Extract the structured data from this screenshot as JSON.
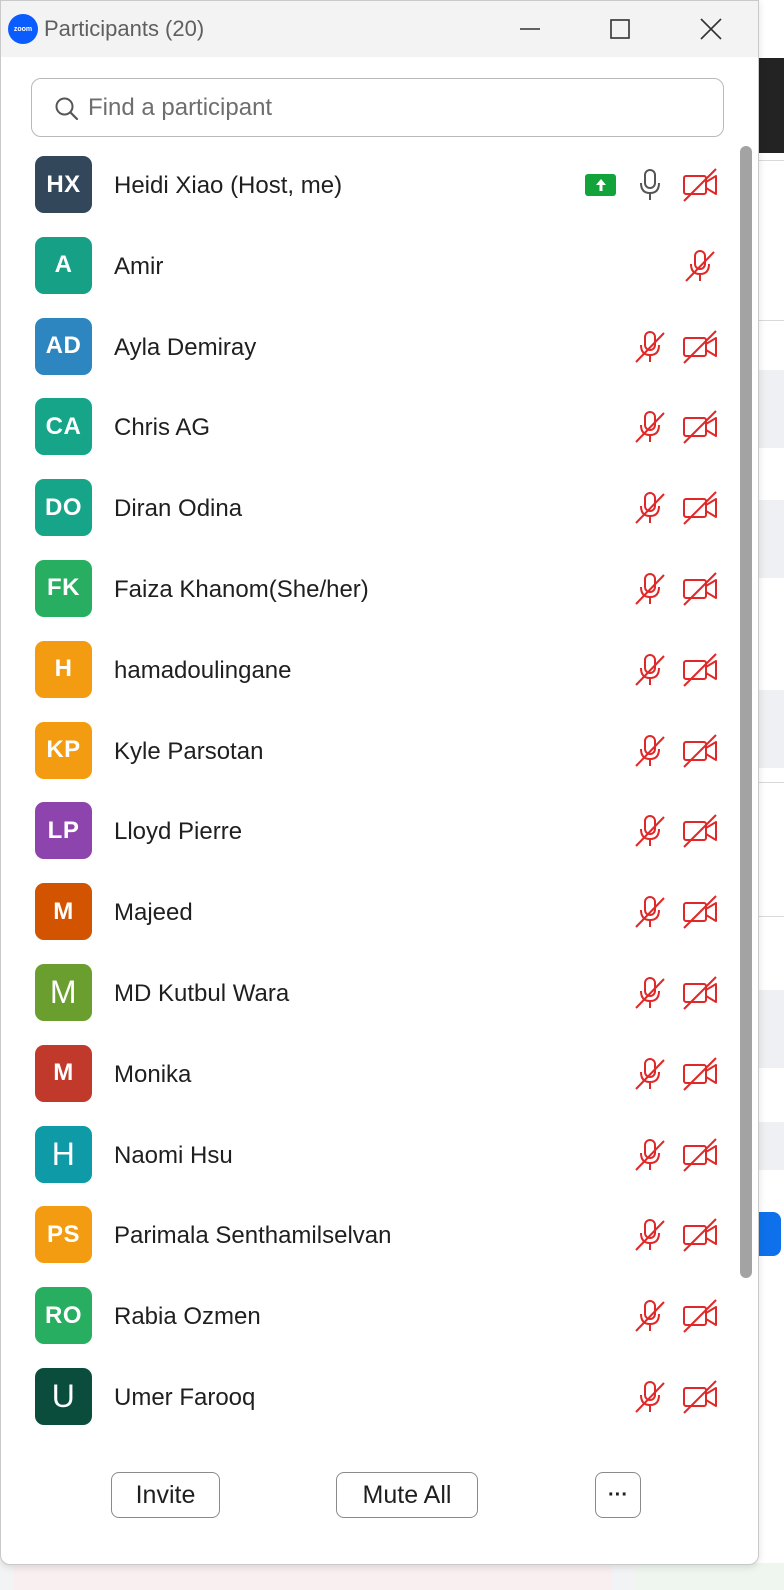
{
  "window": {
    "title": "Participants (20)",
    "logo_text": "zoom"
  },
  "search": {
    "placeholder": "Find a participant",
    "value": ""
  },
  "colors": {
    "muted_red": "#e02828",
    "share_green": "#12a33b",
    "icon_grey": "#555555"
  },
  "participants": [
    {
      "initials": "HX",
      "name": "Heidi Xiao (Host, me)",
      "color": "#33475b",
      "mic": "on",
      "video": "off",
      "sharing": true
    },
    {
      "initials": "A",
      "name": "Amir",
      "color": "#16a085",
      "mic": "off",
      "video": "none",
      "sharing": false
    },
    {
      "initials": "AD",
      "name": "Ayla Demiray",
      "color": "#2e86c1",
      "mic": "off",
      "video": "off",
      "sharing": false
    },
    {
      "initials": "CA",
      "name": "Chris AG",
      "color": "#17a589",
      "mic": "off",
      "video": "off",
      "sharing": false
    },
    {
      "initials": "DO",
      "name": "Diran Odina",
      "color": "#17a589",
      "mic": "off",
      "video": "off",
      "sharing": false
    },
    {
      "initials": "FK",
      "name": "Faiza Khanom(She/her)",
      "color": "#27ae60",
      "mic": "off",
      "video": "off",
      "sharing": false
    },
    {
      "initials": "H",
      "name": "hamadoulingane",
      "color": "#f39c12",
      "mic": "off",
      "video": "off",
      "sharing": false
    },
    {
      "initials": "KP",
      "name": "Kyle Parsotan",
      "color": "#f39c12",
      "mic": "off",
      "video": "off",
      "sharing": false
    },
    {
      "initials": "LP",
      "name": "Lloyd Pierre",
      "color": "#8e44ad",
      "mic": "off",
      "video": "off",
      "sharing": false
    },
    {
      "initials": "M",
      "name": "Majeed",
      "color": "#d35400",
      "mic": "off",
      "video": "off",
      "sharing": false
    },
    {
      "initials": "M",
      "name": "MD Kutbul Wara",
      "color": "#6a9e2f",
      "mic": "off",
      "video": "off",
      "sharing": false,
      "thin": true
    },
    {
      "initials": "M",
      "name": "Monika",
      "color": "#c0392b",
      "mic": "off",
      "video": "off",
      "sharing": false
    },
    {
      "initials": "H",
      "name": "Naomi Hsu",
      "color": "#0e9aa7",
      "mic": "off",
      "video": "off",
      "sharing": false,
      "thin": true
    },
    {
      "initials": "PS",
      "name": "Parimala Senthamilselvan",
      "color": "#f39c12",
      "mic": "off",
      "video": "off",
      "sharing": false
    },
    {
      "initials": "RO",
      "name": "Rabia Ozmen",
      "color": "#27ae60",
      "mic": "off",
      "video": "off",
      "sharing": false
    },
    {
      "initials": "U",
      "name": "Umer Farooq",
      "color": "#0b4d3c",
      "mic": "off",
      "video": "off",
      "sharing": false,
      "thin": true
    }
  ],
  "footer": {
    "invite_label": "Invite",
    "mute_all_label": "Mute All",
    "more_label": "···"
  }
}
